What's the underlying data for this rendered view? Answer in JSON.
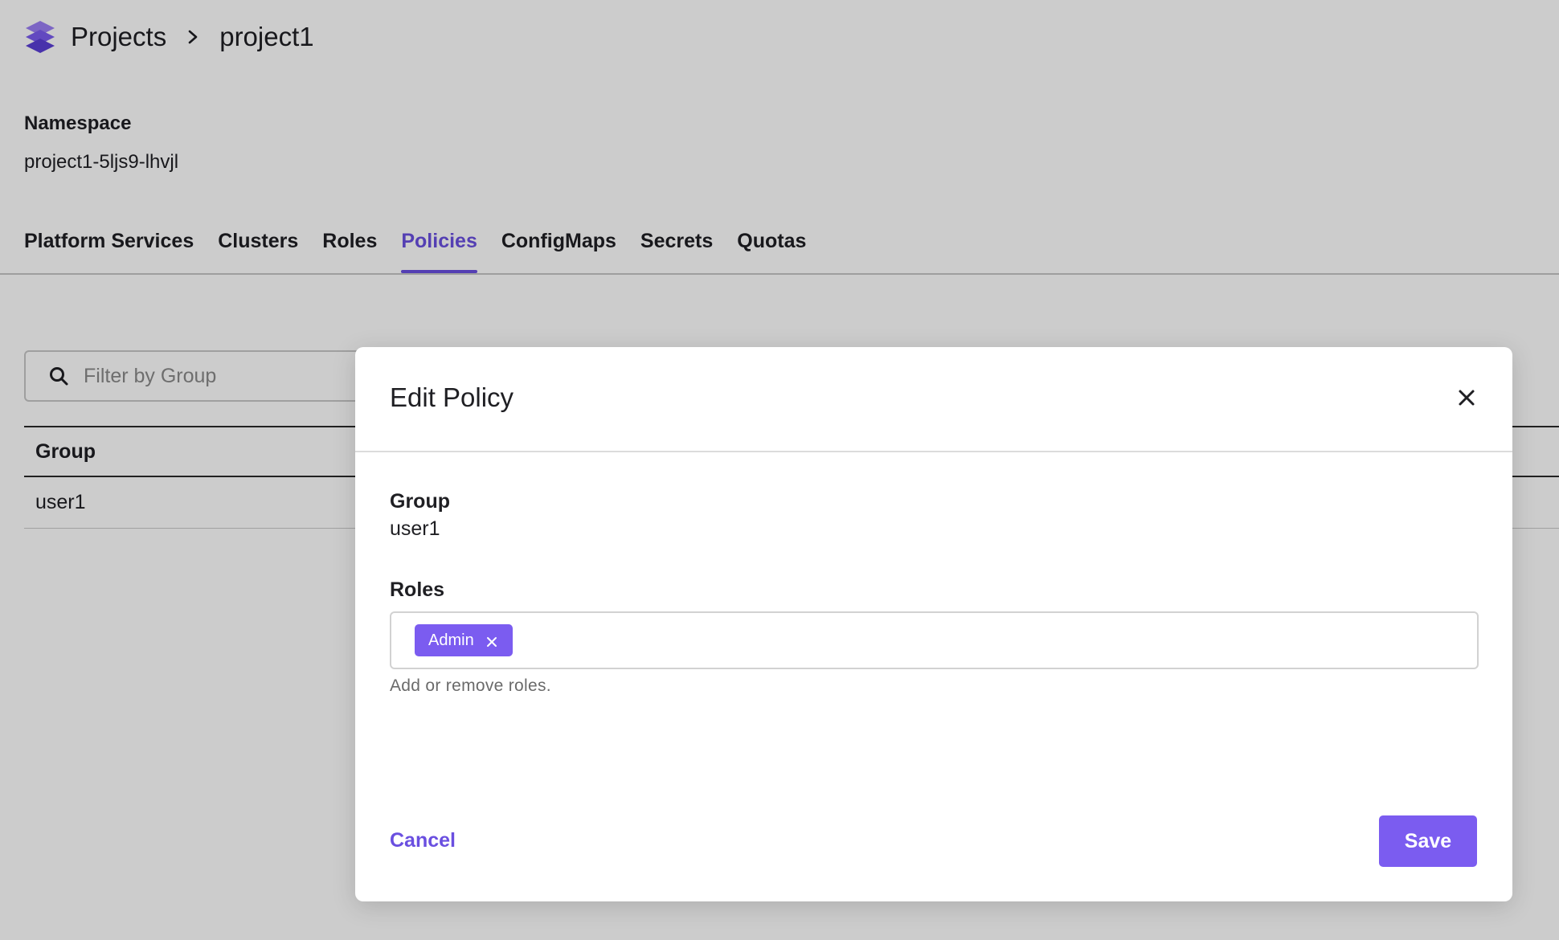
{
  "breadcrumb": {
    "logo_icon": "stacked-layers-icon",
    "root": "Projects",
    "separator_icon": "chevron-right-icon",
    "current": "project1"
  },
  "namespace": {
    "label": "Namespace",
    "value": "project1-5ljs9-lhvjl"
  },
  "tabs": [
    {
      "label": "Platform Services",
      "active": false
    },
    {
      "label": "Clusters",
      "active": false
    },
    {
      "label": "Roles",
      "active": false
    },
    {
      "label": "Policies",
      "active": true
    },
    {
      "label": "ConfigMaps",
      "active": false
    },
    {
      "label": "Secrets",
      "active": false
    },
    {
      "label": "Quotas",
      "active": false
    }
  ],
  "filter": {
    "icon": "search-icon",
    "placeholder": "Filter by Group",
    "value": ""
  },
  "table": {
    "columns": [
      "Group"
    ],
    "rows": [
      {
        "group": "user1"
      }
    ]
  },
  "modal": {
    "title": "Edit Policy",
    "close_icon": "close-icon",
    "group_label": "Group",
    "group_value": "user1",
    "roles_label": "Roles",
    "roles": [
      {
        "label": "Admin",
        "remove_icon": "close-icon"
      }
    ],
    "roles_helper": "Add or remove roles.",
    "cancel_label": "Cancel",
    "save_label": "Save"
  },
  "colors": {
    "accent": "#6a4fe0",
    "chip": "#7b5cf0",
    "overlay": "rgba(0,0,0,0.20)"
  }
}
